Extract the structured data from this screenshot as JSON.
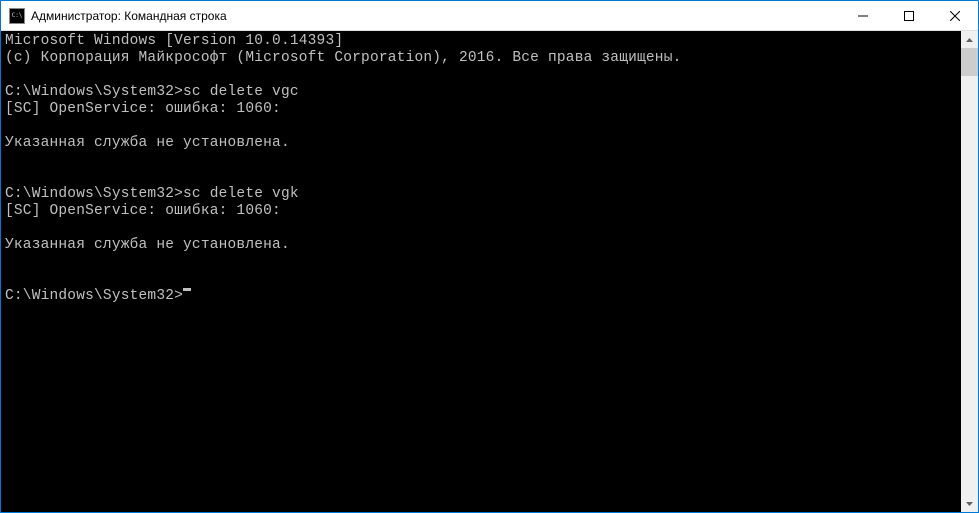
{
  "window": {
    "title": "Администратор: Командная строка"
  },
  "terminal": {
    "lines": [
      "Microsoft Windows [Version 10.0.14393]",
      "(c) Корпорация Майкрософт (Microsoft Corporation), 2016. Все права защищены.",
      "",
      "C:\\Windows\\System32>sc delete vgc",
      "[SC] OpenService: ошибка: 1060:",
      "",
      "Указанная служба не установлена.",
      "",
      "",
      "C:\\Windows\\System32>sc delete vgk",
      "[SC] OpenService: ошибка: 1060:",
      "",
      "Указанная служба не установлена.",
      "",
      ""
    ],
    "prompt": "C:\\Windows\\System32>"
  }
}
